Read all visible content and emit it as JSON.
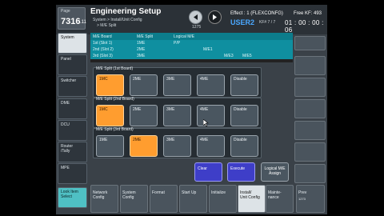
{
  "header": {
    "page_label": "Page",
    "page_number": "7316",
    "page_sub": ".11",
    "title": "Engineering Setup",
    "breadcrumb_1": "System > Install/Unit Config",
    "breadcrumb_2": "> M/E Split",
    "page_count": "1275",
    "effect": "Effect : 1 (FLEXCONFG)",
    "user": "USER2",
    "kf": "KF# 7 / 7",
    "free_kf": "Free KF: 493",
    "timecode": "01 : 00 : 00 : 06"
  },
  "left_nav": [
    {
      "label": "System"
    },
    {
      "label": "Panel"
    },
    {
      "label": "Switcher"
    },
    {
      "label": "DME"
    },
    {
      "label": "DCU"
    },
    {
      "label": "Router\n/Tally"
    },
    {
      "label": "MPE"
    },
    {
      "label": "Look Item\nSelect"
    }
  ],
  "info_table": {
    "headers": [
      "M/E Board",
      "M/E Split",
      "Logical M/E"
    ],
    "rows": [
      [
        "1st (Slot 1)",
        "1ME",
        "P/P"
      ],
      [
        "2nd (Slot 2)",
        "2ME",
        "M/E1"
      ],
      [
        "3rd (Slot 3)",
        "3ME",
        "M/E3",
        "M/E5"
      ]
    ]
  },
  "panels": [
    {
      "title": "M/E Split (1st Board)",
      "options": [
        "1MC",
        "2ME",
        "3ME",
        "4ME",
        "Disable"
      ],
      "selected": 0
    },
    {
      "title": "M/E Split (2nd Board)",
      "options": [
        "1MC",
        "2ME",
        "3ME",
        "4ME",
        "Disable"
      ],
      "selected": 0
    },
    {
      "title": "M/E Split (3rd Board)",
      "options": [
        "1ME",
        "2ME",
        "3ME",
        "4ME",
        "Disable"
      ],
      "selected": 1
    }
  ],
  "actions": {
    "clear": "Clear",
    "execute": "Execute",
    "logical": "Logical M/E\nAssign"
  },
  "bottom_nav": [
    {
      "label": "Network\nConfig"
    },
    {
      "label": "System\nConfig"
    },
    {
      "label": "Format"
    },
    {
      "label": "Start Up"
    },
    {
      "label": "Initialize"
    },
    {
      "label": "Install/\nUnit Config"
    },
    {
      "label": "Mainte-\nnance"
    }
  ],
  "prev": {
    "label": "Prev",
    "num": "1273"
  },
  "colors": {
    "accent_orange": "#ff9d2f",
    "info_teal": "#0f8fa0",
    "action_blue": "#3e3ec8",
    "user_blue": "#4aa8ff"
  }
}
